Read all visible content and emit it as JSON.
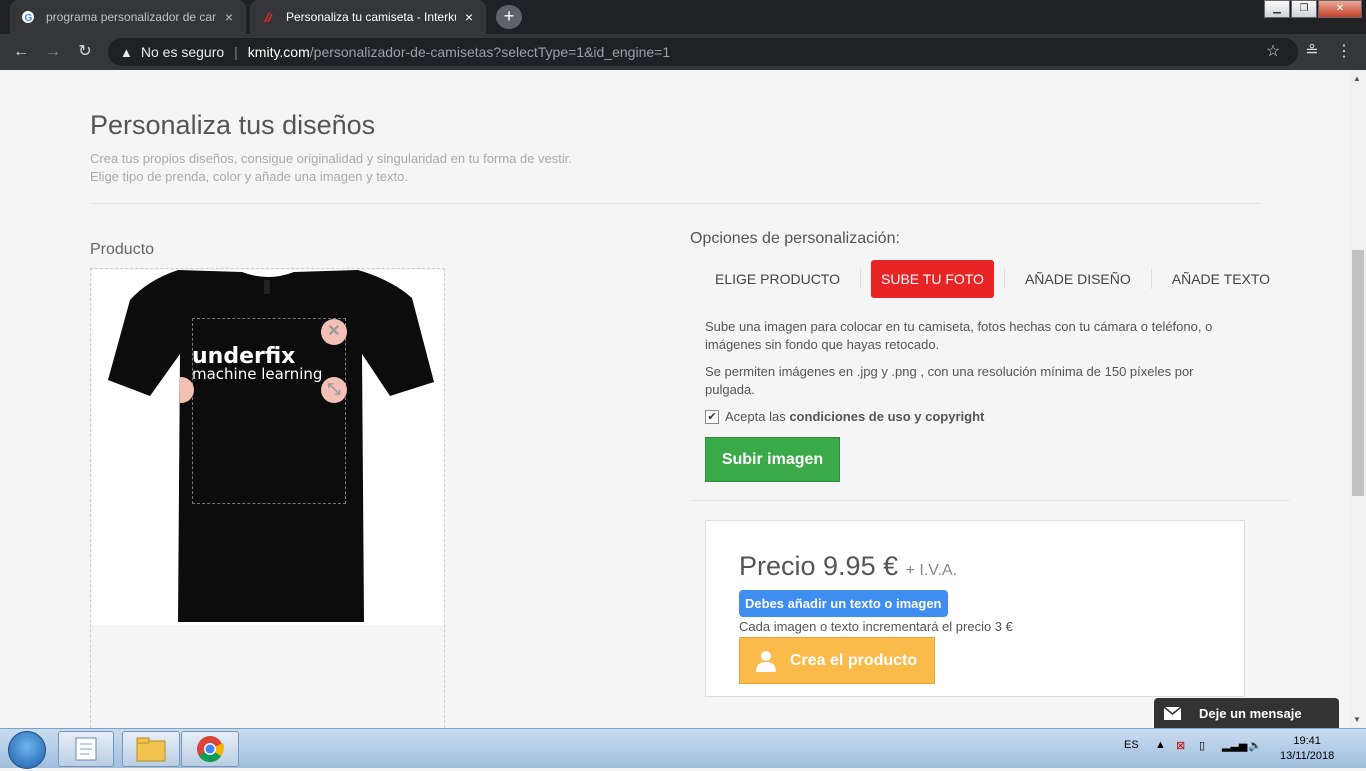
{
  "browser": {
    "tabs": [
      {
        "title": "programa personalizador de cam",
        "close": "×"
      },
      {
        "title": "Personaliza tu camiseta - Interkul",
        "close": "×"
      }
    ],
    "new_tab": "+",
    "window_buttons": [
      "minimize",
      "maximize",
      "close"
    ],
    "security": "No es seguro",
    "url_domain": "kmity.com",
    "url_path": "/personalizador-de-camisetas?selectType=1&id_engine=1"
  },
  "page": {
    "title": "Personaliza tus diseños",
    "subtitle_line1": "Crea tus propios diseños, consigue originalidad y singularidad en tu forma de vestir.",
    "subtitle_line2": "Elige tipo de prenda, color y añade una imagen y texto.",
    "product_label": "Producto",
    "design_text1": "underfix",
    "design_text2": "machine learning",
    "options_title": "Opciones de personalización:",
    "option_tabs": [
      "ELIGE PRODUCTO",
      "SUBE TU FOTO",
      "AÑADE DISEÑO",
      "AÑADE TEXTO"
    ],
    "active_tab": "SUBE TU FOTO",
    "desc1": "Sube una imagen para colocar en tu camiseta, fotos hechas con tu cámara o teléfono, o imágenes sin fondo que hayas retocado.",
    "desc2": "Se permiten imágenes en .jpg y .png , con una resolución mínima de 150 píxeles por pulgada.",
    "accept_prefix": "Acepta las ",
    "accept_bold": "condiciones de uso y copyright",
    "accept_checked": true,
    "upload_button": "Subir imagen",
    "price_label": "Precio 9.95 €",
    "price_tax": "+ I.V.A.",
    "warning_badge": "Debes añadir un texto o imagen",
    "increment_note": "Cada imagen o texto incrementará el precio 3 €",
    "create_button": "Crea el producto",
    "chat_label": "Deje un mensaje"
  },
  "taskbar": {
    "language": "ES",
    "time": "19:41",
    "date": "13/11/2018"
  },
  "colors": {
    "active_tab": "#e82424",
    "upload_button": "#3aaa48",
    "warning_badge": "#3d8ef0",
    "create_button": "#fbbb4b",
    "chat": "#333333"
  }
}
